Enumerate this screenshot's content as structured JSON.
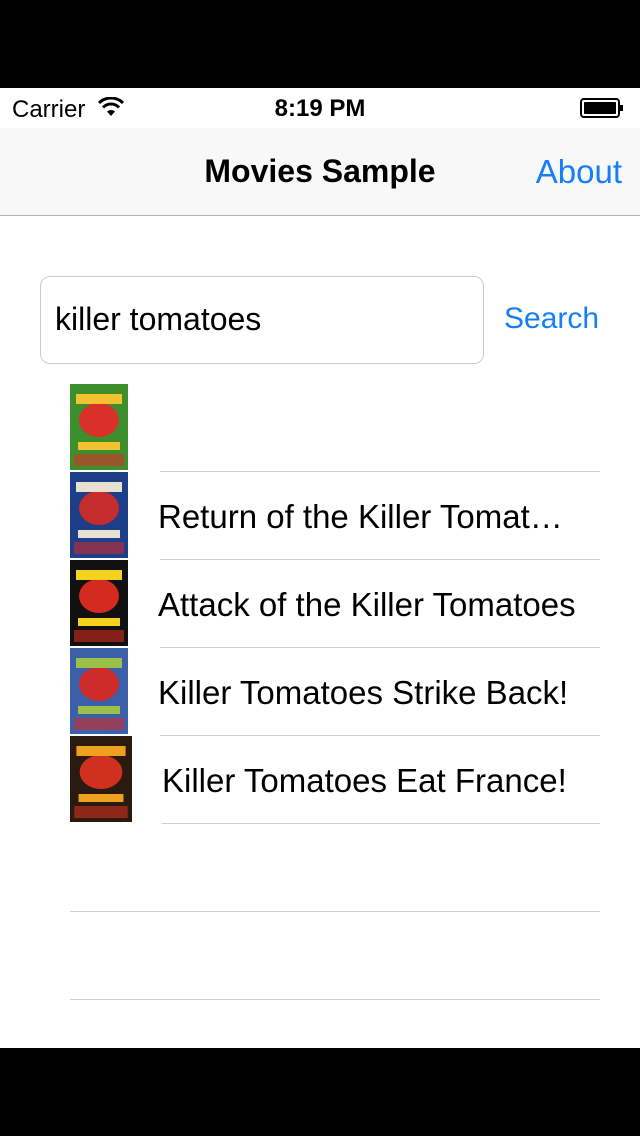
{
  "status_bar": {
    "carrier": "Carrier",
    "time": "8:19 PM",
    "wifi_icon": "wifi-icon",
    "battery_icon": "battery-icon"
  },
  "nav": {
    "title": "Movies Sample",
    "about_label": "About"
  },
  "search": {
    "value": "killer tomatoes",
    "button_label": "Search"
  },
  "results": [
    {
      "title": "",
      "poster_colors": [
        "#3d8f2e",
        "#d9312a",
        "#f2c230"
      ]
    },
    {
      "title": "Return of the Killer Tomatoes!",
      "poster_colors": [
        "#1d3f8a",
        "#c52c2c",
        "#e8e0d0"
      ]
    },
    {
      "title": "Attack of the Killer Tomatoes",
      "poster_colors": [
        "#111111",
        "#d32b1f",
        "#f5d21f"
      ]
    },
    {
      "title": "Killer Tomatoes Strike Back!",
      "poster_colors": [
        "#3b5fa8",
        "#cf2b2b",
        "#9ac04a"
      ]
    },
    {
      "title": "Killer Tomatoes Eat France!",
      "poster_colors": [
        "#2a1a10",
        "#d03020",
        "#f0a020"
      ]
    }
  ],
  "colors": {
    "accent": "#147efb",
    "separator": "#cfcfcf"
  }
}
